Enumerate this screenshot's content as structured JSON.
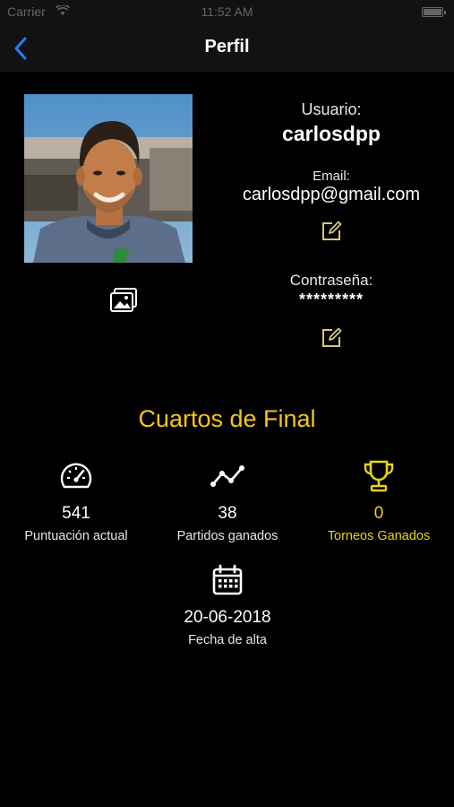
{
  "status_bar": {
    "carrier": "Carrier",
    "time": "11:52 AM"
  },
  "nav": {
    "title": "Perfil"
  },
  "profile": {
    "usuario_label": "Usuario:",
    "usuario_value": "carlosdpp",
    "email_label": "Email:",
    "email_value": "carlosdpp@gmail.com",
    "password_label": "Contraseña:",
    "password_value": "*********"
  },
  "round": {
    "title": "Cuartos de Final"
  },
  "stats": {
    "puntuacion": {
      "value": "541",
      "label": "Puntuación actual"
    },
    "partidos": {
      "value": "38",
      "label": "Partidos ganados"
    },
    "torneos": {
      "value": "0",
      "label": "Torneos Ganados"
    },
    "fecha": {
      "value": "20-06-2018",
      "label": "Fecha de alta"
    }
  },
  "icons": [
    "wifi-icon",
    "battery-icon",
    "back-chevron-icon",
    "avatar-photo",
    "image-picker-icon",
    "edit-icon",
    "speedometer-icon",
    "line-chart-icon",
    "trophy-icon",
    "calendar-icon"
  ],
  "colors": {
    "accent": "#f5c518",
    "trophy": "#e8d316",
    "back": "#2f7bf5",
    "edit": "#d4c87a",
    "background": "#000000",
    "bar": "#121212"
  }
}
